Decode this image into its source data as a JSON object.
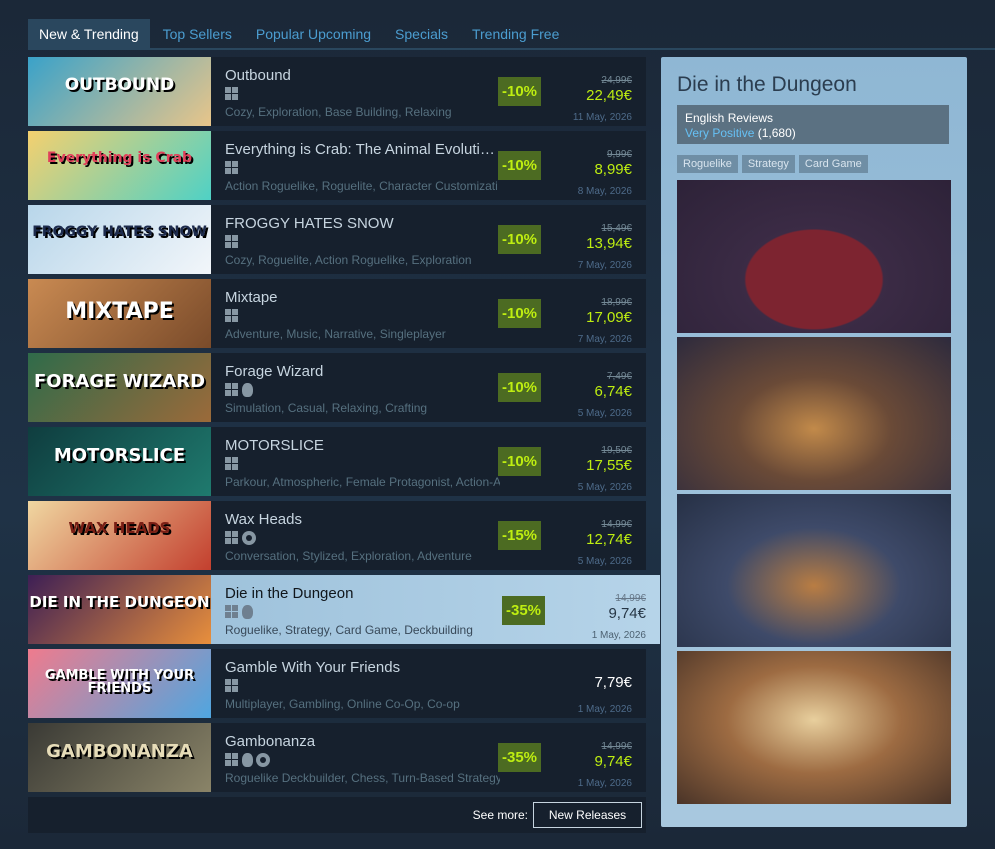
{
  "tabs": [
    "New & Trending",
    "Top Sellers",
    "Popular Upcoming",
    "Specials",
    "Trending Free"
  ],
  "games": [
    {
      "name": "Outbound",
      "capsule": "OUTBOUND",
      "tags": "Cozy, Exploration, Base Building, Relaxing",
      "discount": "-10%",
      "original": "24,99€",
      "final": "22,49€",
      "date": "11 May, 2026",
      "platforms": [
        "windows-icon"
      ]
    },
    {
      "name": "Everything is Crab: The Animal Evoluti…",
      "capsule": "Everything is Crab",
      "tags": "Action Roguelike, Roguelite, Character Customizati",
      "discount": "-10%",
      "original": "9,99€",
      "final": "8,99€",
      "date": "8 May, 2026",
      "platforms": [
        "windows-icon"
      ]
    },
    {
      "name": "FROGGY HATES SNOW",
      "capsule": "FROGGY HATES SNOW",
      "tags": "Cozy, Roguelite, Action Roguelike, Exploration",
      "discount": "-10%",
      "original": "15,49€",
      "final": "13,94€",
      "date": "7 May, 2026",
      "platforms": [
        "windows-icon"
      ]
    },
    {
      "name": "Mixtape",
      "capsule": "MIXTAPE",
      "tags": "Adventure, Music, Narrative, Singleplayer",
      "discount": "-10%",
      "original": "18,99€",
      "final": "17,09€",
      "date": "7 May, 2026",
      "platforms": [
        "windows-icon"
      ]
    },
    {
      "name": "Forage Wizard",
      "capsule": "FORAGE WIZARD",
      "tags": "Simulation, Casual, Relaxing, Crafting",
      "discount": "-10%",
      "original": "7,49€",
      "final": "6,74€",
      "date": "5 May, 2026",
      "platforms": [
        "windows-icon",
        "apple-icon"
      ]
    },
    {
      "name": "MOTORSLICE",
      "capsule": "MOTORSLICE",
      "tags": "Parkour, Atmospheric, Female Protagonist, Action-A",
      "discount": "-10%",
      "original": "19,50€",
      "final": "17,55€",
      "date": "5 May, 2026",
      "platforms": [
        "windows-icon"
      ]
    },
    {
      "name": "Wax Heads",
      "capsule": "WAX HEADS",
      "tags": "Conversation, Stylized, Exploration, Adventure",
      "discount": "-15%",
      "original": "14,99€",
      "final": "12,74€",
      "date": "5 May, 2026",
      "platforms": [
        "windows-icon",
        "steam-icon"
      ]
    },
    {
      "name": "Die in the Dungeon",
      "capsule": "DIE IN THE DUNGEON",
      "tags": "Roguelike, Strategy, Card Game, Deckbuilding",
      "discount": "-35%",
      "original": "14,99€",
      "final": "9,74€",
      "date": "1 May, 2026",
      "platforms": [
        "windows-icon",
        "apple-icon"
      ]
    },
    {
      "name": "Gamble With Your Friends",
      "capsule": "GAMBLE WITH YOUR FRIENDS",
      "tags": "Multiplayer, Gambling, Online Co-Op, Co-op",
      "discount": "",
      "original": "",
      "final": "7,79€",
      "date": "1 May, 2026",
      "platforms": [
        "windows-icon"
      ]
    },
    {
      "name": "Gambonanza",
      "capsule": "GAMBONANZA",
      "tags": "Roguelike Deckbuilder, Chess, Turn-Based Strategy",
      "discount": "-35%",
      "original": "14,99€",
      "final": "9,74€",
      "date": "1 May, 2026",
      "platforms": [
        "windows-icon",
        "apple-icon",
        "steam-icon"
      ]
    }
  ],
  "see_more": {
    "label": "See more:",
    "button": "New Releases"
  },
  "detail": {
    "title": "Die in the Dungeon",
    "reviews_label": "English Reviews",
    "reviews_rating": "Very Positive",
    "reviews_count": "(1,680)",
    "tags": [
      "Roguelike",
      "Strategy",
      "Card Game"
    ],
    "screenshot_count": 4
  },
  "colors": {
    "accent": "#66c0f4",
    "discount_bg": "#4c6b22",
    "discount_text": "#beee11",
    "background": "#1b2838"
  }
}
